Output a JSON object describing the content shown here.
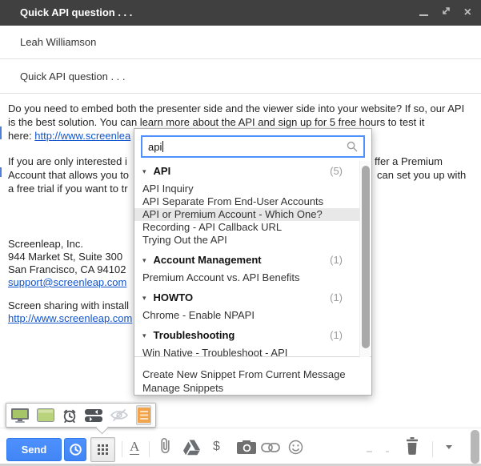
{
  "titlebar": {
    "title": "Quick API question . . ."
  },
  "fields": {
    "to": "Leah Williamson",
    "subject": "Quick API question . . ."
  },
  "body": {
    "para1_line1": "Do you need to embed both the presenter side and the viewer side into your website? If so, our API",
    "para1_line2": "is the best solution. You can learn more about the API and sign up for 5 free hours to test it",
    "para1_line3_prefix": "here: ",
    "para1_line3_link": "http://www.screenlea",
    "para2_line1_left": "If you are only interested i",
    "para2_line1_right": "ffer a Premium",
    "para2_line2_left": "Account that allows you to",
    "para2_line2_right": "can set you up with",
    "para2_line3_left": "a free trial if you want to tr",
    "signature_line1": "Screenleap, Inc.",
    "signature_line2": "944 Market St, Suite 300",
    "signature_line3": "San Francisco, CA 94102",
    "signature_email": "support@screenleap.com",
    "tagline": "Screen sharing with install",
    "tagline_link": "http://www.screenleap.com"
  },
  "snippet_picker": {
    "search_value": "api",
    "groups": [
      {
        "label": "API",
        "count": "(5)",
        "items": [
          "API Inquiry",
          "API Separate From End-User Accounts",
          "API or Premium Account - Which One?",
          "Recording - API Callback URL",
          "Trying Out the API"
        ]
      },
      {
        "label": "Account Management",
        "count": "(1)",
        "items": [
          "Premium Account vs. API Benefits"
        ]
      },
      {
        "label": "HOWTO",
        "count": "(1)",
        "items": [
          "Chrome - Enable NPAPI"
        ]
      },
      {
        "label": "Troubleshooting",
        "count": "(1)",
        "items": [
          "Win Native - Troubleshoot - API"
        ]
      }
    ],
    "collapse_glyph": "▾",
    "actions": [
      "Create New Snippet From Current Message",
      "Manage Snippets"
    ]
  },
  "toolbar": {
    "send_label": "Send",
    "formatting_glyph": "A",
    "money_glyph": "$",
    "icons": [
      "schedule-send",
      "snippets-grid",
      "formatting",
      "attach-file",
      "insert-drive-file",
      "request-money",
      "insert-photo",
      "insert-link",
      "insert-emoji",
      "discard-draft",
      "more-options"
    ]
  },
  "extension_bar": {
    "icons": [
      "share-screen",
      "share-window",
      "timer",
      "swap-presenter",
      "hide-viewer",
      "snippets"
    ]
  },
  "colors": {
    "titlebar_bg": "#404040",
    "send_blue": "#4d90fe",
    "send_border": "#3079ed",
    "link_blue": "#1155cc",
    "search_focus_border": "#4d90fe",
    "snippet_orange": "#f2a44c",
    "screen_green": "#a5c566",
    "highlight_row_bg": "#e8e8e8"
  }
}
